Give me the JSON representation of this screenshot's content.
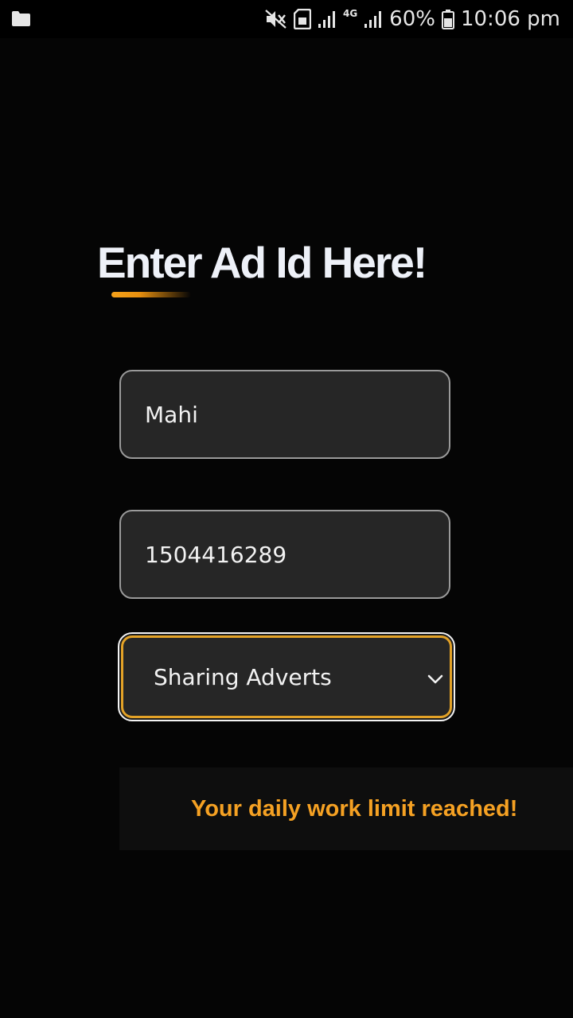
{
  "status_bar": {
    "left_icon": "folder-icon",
    "icons": [
      "mute-icon",
      "sim-icon",
      "signal-icon",
      "signal-icon"
    ],
    "network_type": "4G",
    "battery_percent": "60%",
    "time": "10:06 pm"
  },
  "form": {
    "title": "Enter Ad Id Here!",
    "name_value": "Mahi",
    "id_value": "1504416289",
    "select_value": "Sharing Adverts"
  },
  "message": {
    "text": "Your daily work limit reached!"
  },
  "colors": {
    "background": "#050505",
    "accent": "#e3a227",
    "message": "#f5a123",
    "field_bg": "#262626"
  }
}
